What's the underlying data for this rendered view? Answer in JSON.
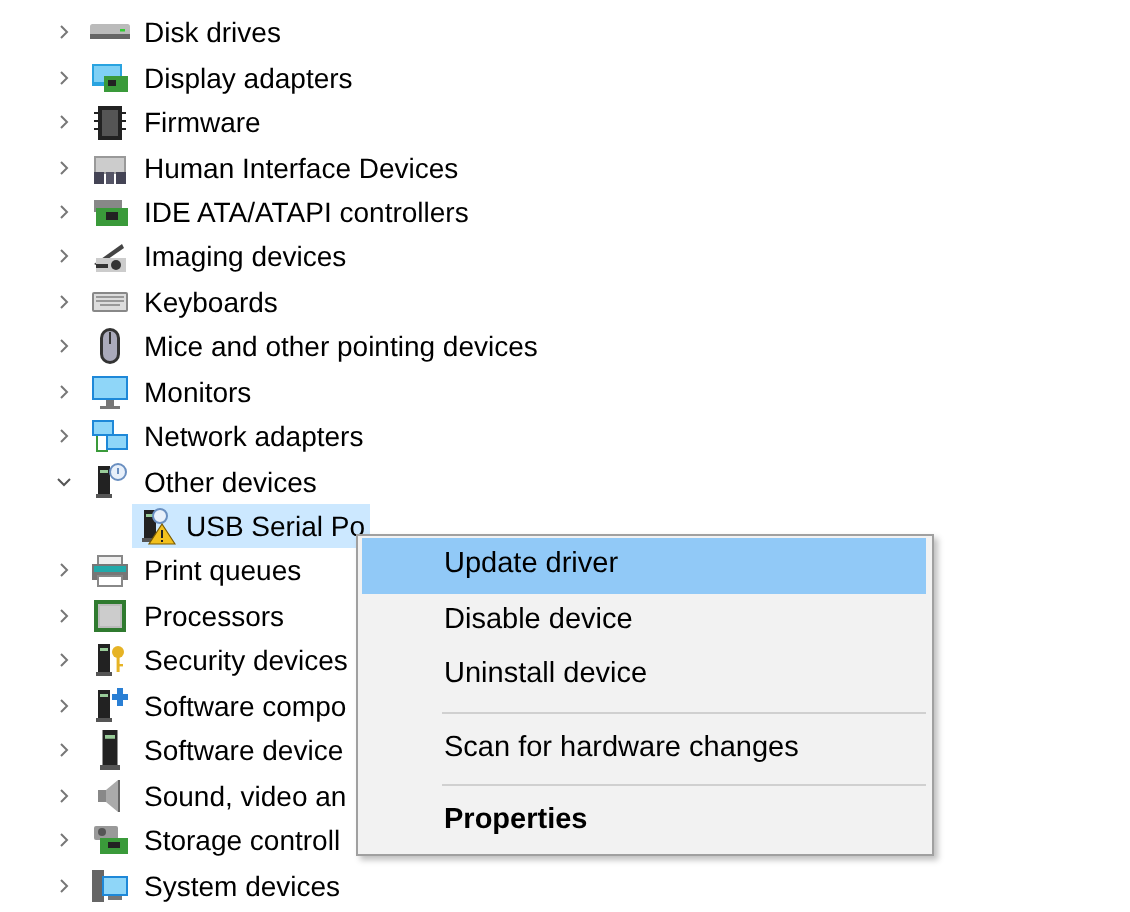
{
  "tree": {
    "items": [
      {
        "label": "Disk drives",
        "expanded": false
      },
      {
        "label": "Display adapters",
        "expanded": false
      },
      {
        "label": "Firmware",
        "expanded": false
      },
      {
        "label": "Human Interface Devices",
        "expanded": false
      },
      {
        "label": "IDE ATA/ATAPI controllers",
        "expanded": false
      },
      {
        "label": "Imaging devices",
        "expanded": false
      },
      {
        "label": "Keyboards",
        "expanded": false
      },
      {
        "label": "Mice and other pointing devices",
        "expanded": false
      },
      {
        "label": "Monitors",
        "expanded": false
      },
      {
        "label": "Network adapters",
        "expanded": false
      },
      {
        "label": "Other devices",
        "expanded": true,
        "children": [
          {
            "label": "USB Serial Po",
            "selected": true
          }
        ]
      },
      {
        "label": "Print queues",
        "expanded": false
      },
      {
        "label": "Processors",
        "expanded": false
      },
      {
        "label": "Security devices",
        "expanded": false
      },
      {
        "label": "Software compo",
        "expanded": false
      },
      {
        "label": "Software device",
        "expanded": false
      },
      {
        "label": "Sound, video an",
        "expanded": false
      },
      {
        "label": "Storage controll",
        "expanded": false
      },
      {
        "label": "System devices",
        "expanded": false
      }
    ]
  },
  "context_menu": {
    "groups": [
      [
        {
          "label": "Update driver",
          "selected": true,
          "default": false
        },
        {
          "label": "Disable device",
          "selected": false,
          "default": false
        },
        {
          "label": "Uninstall device",
          "selected": false,
          "default": false
        }
      ],
      [
        {
          "label": "Scan for hardware changes",
          "selected": false,
          "default": false
        }
      ],
      [
        {
          "label": "Properties",
          "selected": false,
          "default": true
        }
      ]
    ]
  }
}
